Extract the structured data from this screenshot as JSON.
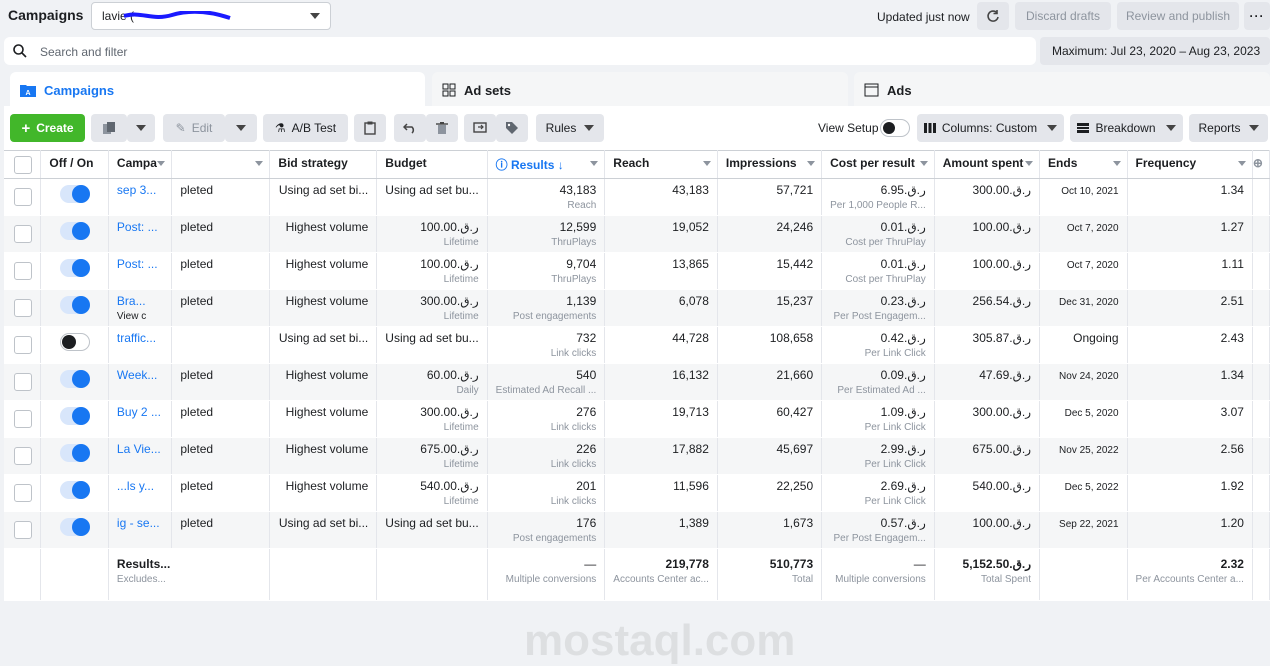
{
  "topbar": {
    "title": "Campaigns",
    "account_value": "lavie (",
    "updated": "Updated just now",
    "discard_label": "Discard drafts",
    "review_label": "Review and publish",
    "more_label": "···"
  },
  "search": {
    "placeholder": "Search and filter"
  },
  "date_range": "Maximum: Jul 23, 2020 – Aug 23, 2023",
  "tabs": [
    {
      "label": "Campaigns",
      "icon": "folder-icon"
    },
    {
      "label": "Ad sets",
      "icon": "grid-icon"
    },
    {
      "label": "Ads",
      "icon": "ad-icon"
    }
  ],
  "toolbar": {
    "create": "Create",
    "edit": "Edit",
    "ab_test": "A/B Test",
    "rules": "Rules",
    "view_setup": "View Setup",
    "columns": "Columns: Custom",
    "breakdown": "Breakdown",
    "reports": "Reports"
  },
  "columns": [
    "Off / On",
    "Campa",
    "",
    "Bid strategy",
    "Budget",
    "Results ↓",
    "Reach",
    "Impressions",
    "Cost per result",
    "Amount spent",
    "Ends",
    "Frequency"
  ],
  "rows": [
    {
      "name": "sep 3...",
      "status": "pleted",
      "bid": "Using ad set bi...",
      "budget": "Using ad set bu...",
      "budget_sub": "",
      "results": "43,183",
      "results_sub": "Reach",
      "reach": "43,183",
      "impressions": "57,721",
      "cpr": "ر.ق.6.95",
      "cpr_sub": "Per 1,000 People R...",
      "spent": "ر.ق.300.00",
      "ends": "Oct 10, 2021",
      "frequency": "1.34",
      "on": true
    },
    {
      "name": "Post: ...",
      "status": "pleted",
      "bid": "Highest volume",
      "budget": "ر.ق.100.00",
      "budget_sub": "Lifetime",
      "results": "12,599",
      "results_sub": "ThruPlays",
      "reach": "19,052",
      "impressions": "24,246",
      "cpr": "ر.ق.0.01",
      "cpr_sub": "Cost per ThruPlay",
      "spent": "ر.ق.100.00",
      "ends": "Oct 7, 2020",
      "frequency": "1.27",
      "on": true
    },
    {
      "name": "Post: ...",
      "status": "pleted",
      "bid": "Highest volume",
      "budget": "ر.ق.100.00",
      "budget_sub": "Lifetime",
      "results": "9,704",
      "results_sub": "ThruPlays",
      "reach": "13,865",
      "impressions": "15,442",
      "cpr": "ر.ق.0.01",
      "cpr_sub": "Cost per ThruPlay",
      "spent": "ر.ق.100.00",
      "ends": "Oct 7, 2020",
      "frequency": "1.11",
      "on": true
    },
    {
      "name": "Bra...",
      "name_sub": "View c",
      "status": "pleted",
      "bid": "Highest volume",
      "budget": "ر.ق.300.00",
      "budget_sub": "Lifetime",
      "results": "1,139",
      "results_sub": "Post engagements",
      "reach": "6,078",
      "impressions": "15,237",
      "cpr": "ر.ق.0.23",
      "cpr_sub": "Per Post Engagem...",
      "spent": "ر.ق.256.54",
      "ends": "Dec 31, 2020",
      "frequency": "2.51",
      "on": true
    },
    {
      "name": "traffic...",
      "status": "",
      "bid": "Using ad set bi...",
      "budget": "Using ad set bu...",
      "budget_sub": "",
      "results": "732",
      "results_sub": "Link clicks",
      "reach": "44,728",
      "impressions": "108,658",
      "cpr": "ر.ق.0.42",
      "cpr_sub": "Per Link Click",
      "spent": "ر.ق.305.87",
      "ends": "Ongoing",
      "frequency": "2.43",
      "on": false
    },
    {
      "name": "Week...",
      "status": "pleted",
      "bid": "Highest volume",
      "budget": "ر.ق.60.00",
      "budget_sub": "Daily",
      "results": "540",
      "results_sub": "Estimated Ad Recall ...",
      "reach": "16,132",
      "impressions": "21,660",
      "cpr": "ر.ق.0.09",
      "cpr_sub": "Per Estimated Ad ...",
      "spent": "ر.ق.47.69",
      "ends": "Nov 24, 2020",
      "frequency": "1.34",
      "on": true
    },
    {
      "name": "Buy 2 ...",
      "status": "pleted",
      "bid": "Highest volume",
      "budget": "ر.ق.300.00",
      "budget_sub": "Lifetime",
      "results": "276",
      "results_sub": "Link clicks",
      "reach": "19,713",
      "impressions": "60,427",
      "cpr": "ر.ق.1.09",
      "cpr_sub": "Per Link Click",
      "spent": "ر.ق.300.00",
      "ends": "Dec 5, 2020",
      "frequency": "3.07",
      "on": true
    },
    {
      "name": "La Vie...",
      "status": "pleted",
      "bid": "Highest volume",
      "budget": "ر.ق.675.00",
      "budget_sub": "Lifetime",
      "results": "226",
      "results_sub": "Link clicks",
      "reach": "17,882",
      "impressions": "45,697",
      "cpr": "ر.ق.2.99",
      "cpr_sub": "Per Link Click",
      "spent": "ر.ق.675.00",
      "ends": "Nov 25, 2022",
      "frequency": "2.56",
      "on": true
    },
    {
      "name": "...ls y...",
      "status": "pleted",
      "bid": "Highest volume",
      "budget": "ر.ق.540.00",
      "budget_sub": "Lifetime",
      "results": "201",
      "results_sub": "Link clicks",
      "reach": "11,596",
      "impressions": "22,250",
      "cpr": "ر.ق.2.69",
      "cpr_sub": "Per Link Click",
      "spent": "ر.ق.540.00",
      "ends": "Dec 5, 2022",
      "frequency": "1.92",
      "on": true
    },
    {
      "name": "ig - se...",
      "status": "pleted",
      "bid": "Using ad set bi...",
      "budget": "Using ad set bu...",
      "budget_sub": "",
      "results": "176",
      "results_sub": "Post engagements",
      "reach": "1,389",
      "impressions": "1,673",
      "cpr": "ر.ق.0.57",
      "cpr_sub": "Per Post Engagem...",
      "spent": "ر.ق.100.00",
      "ends": "Sep 22, 2021",
      "frequency": "1.20",
      "on": true
    }
  ],
  "footer": {
    "label": "Results...",
    "label_sub": "Excludes...",
    "results": "—",
    "results_sub": "Multiple conversions",
    "reach": "219,778",
    "reach_sub": "Accounts Center ac...",
    "impressions": "510,773",
    "impressions_sub": "Total",
    "cpr": "—",
    "cpr_sub": "Multiple conversions",
    "spent": "ر.ق.5,152.50",
    "spent_sub": "Total Spent",
    "frequency": "2.32",
    "frequency_sub": "Per Accounts Center a..."
  },
  "watermark": "mostaql.com"
}
